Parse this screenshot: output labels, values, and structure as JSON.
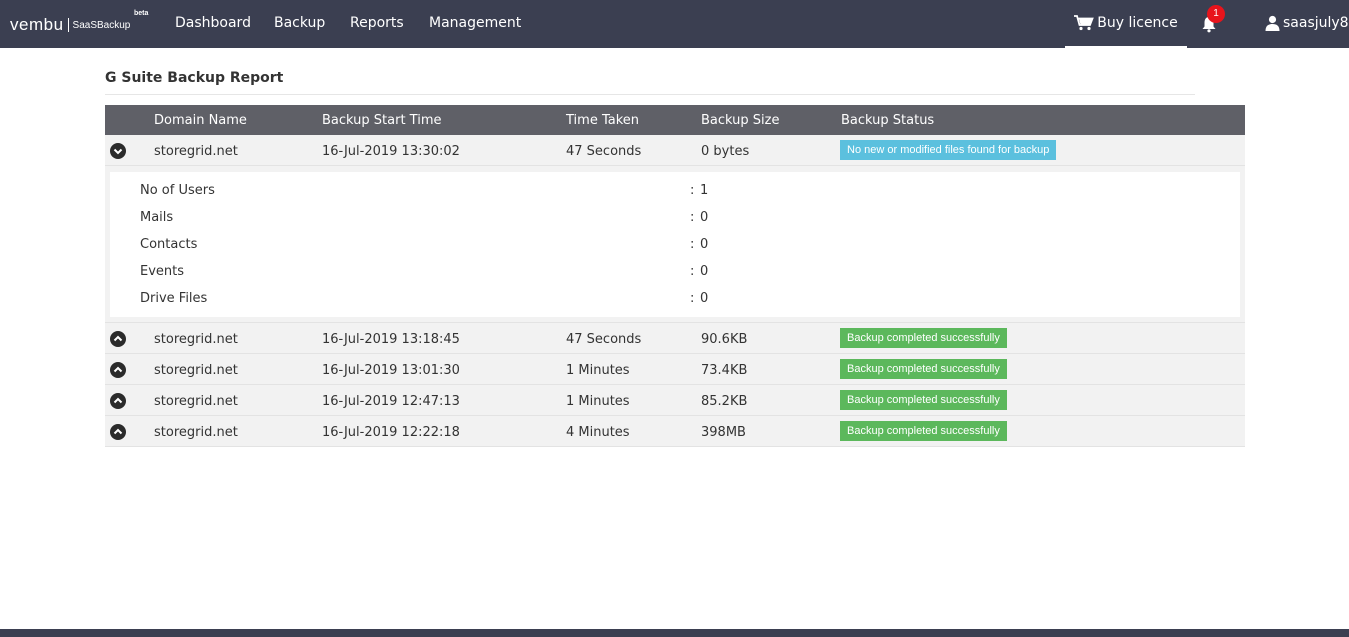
{
  "brand": {
    "word": "vembu",
    "product": "SaaSBackup",
    "beta": "beta"
  },
  "nav": {
    "items": [
      "Dashboard",
      "Backup",
      "Reports",
      "Management"
    ]
  },
  "header": {
    "buy_label": "Buy licence",
    "notification_count": "1",
    "username": "saasjuly8"
  },
  "page": {
    "title": "G Suite Backup Report"
  },
  "table": {
    "columns": [
      "Domain Name",
      "Backup Start Time",
      "Time Taken",
      "Backup Size",
      "Backup Status"
    ],
    "rows": [
      {
        "domain": "storegrid.net",
        "start": "16-Jul-2019 13:30:02",
        "time": "47 Seconds",
        "size": "0 bytes",
        "status": "No new or modified files found for backup",
        "status_type": "info",
        "expanded": true
      },
      {
        "domain": "storegrid.net",
        "start": "16-Jul-2019 13:18:45",
        "time": "47 Seconds",
        "size": "90.6KB",
        "status": "Backup completed successfully",
        "status_type": "success",
        "expanded": false
      },
      {
        "domain": "storegrid.net",
        "start": "16-Jul-2019 13:01:30",
        "time": "1 Minutes",
        "size": "73.4KB",
        "status": "Backup completed successfully",
        "status_type": "success",
        "expanded": false
      },
      {
        "domain": "storegrid.net",
        "start": "16-Jul-2019 12:47:13",
        "time": "1 Minutes",
        "size": "85.2KB",
        "status": "Backup completed successfully",
        "status_type": "success",
        "expanded": false
      },
      {
        "domain": "storegrid.net",
        "start": "16-Jul-2019 12:22:18",
        "time": "4 Minutes",
        "size": "398MB",
        "status": "Backup completed successfully",
        "status_type": "success",
        "expanded": false
      }
    ],
    "details": [
      {
        "label": "No of Users",
        "value": "1"
      },
      {
        "label": "Mails",
        "value": "0"
      },
      {
        "label": "Contacts",
        "value": "0"
      },
      {
        "label": "Events",
        "value": "0"
      },
      {
        "label": "Drive Files",
        "value": "0"
      }
    ],
    "detail_separator": ":"
  },
  "colors": {
    "topbar": "#3b3f51",
    "table_header": "#5f6067",
    "info": "#5bc0de",
    "success": "#5cb85c",
    "badge_red": "#e8141c"
  }
}
